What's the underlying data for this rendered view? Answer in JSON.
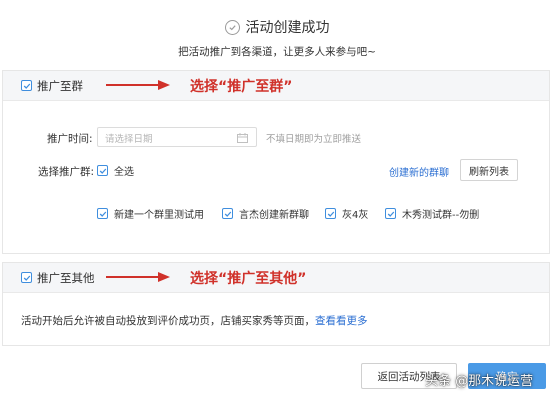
{
  "header": {
    "title": "活动创建成功",
    "subtitle": "把活动推广到各渠道，让更多人来参与吧~"
  },
  "group_section": {
    "label": "推广至群",
    "annotation": "选择“推广至群”",
    "time_label": "推广时间:",
    "date_placeholder": "请选择日期",
    "date_hint": "不填日期即为立即推送",
    "groups_label": "选择推广群:",
    "select_all": "全选",
    "create_group_link": "创建新的群聊",
    "refresh_button": "刷新列表",
    "groups": [
      {
        "label": "新建一个群里测试用"
      },
      {
        "label": "言杰创建新群聊"
      },
      {
        "label": "灰4灰"
      },
      {
        "label": "木秀测试群--勿删"
      }
    ]
  },
  "other_section": {
    "label": "推广至其他",
    "annotation": "选择“推广至其他”",
    "description": "活动开始后允许被自动投放到评价成功页，店铺买家秀等页面，",
    "view_more_link": "查看看更多"
  },
  "footer": {
    "back_button": "返回活动列表",
    "confirm_button": "确定"
  },
  "watermark": "头条 @那木说运营",
  "colors": {
    "accent": "#3f8ede",
    "annotation": "#d0312a",
    "link": "#2a6ed2",
    "primary_button": "#4a9ae6"
  }
}
